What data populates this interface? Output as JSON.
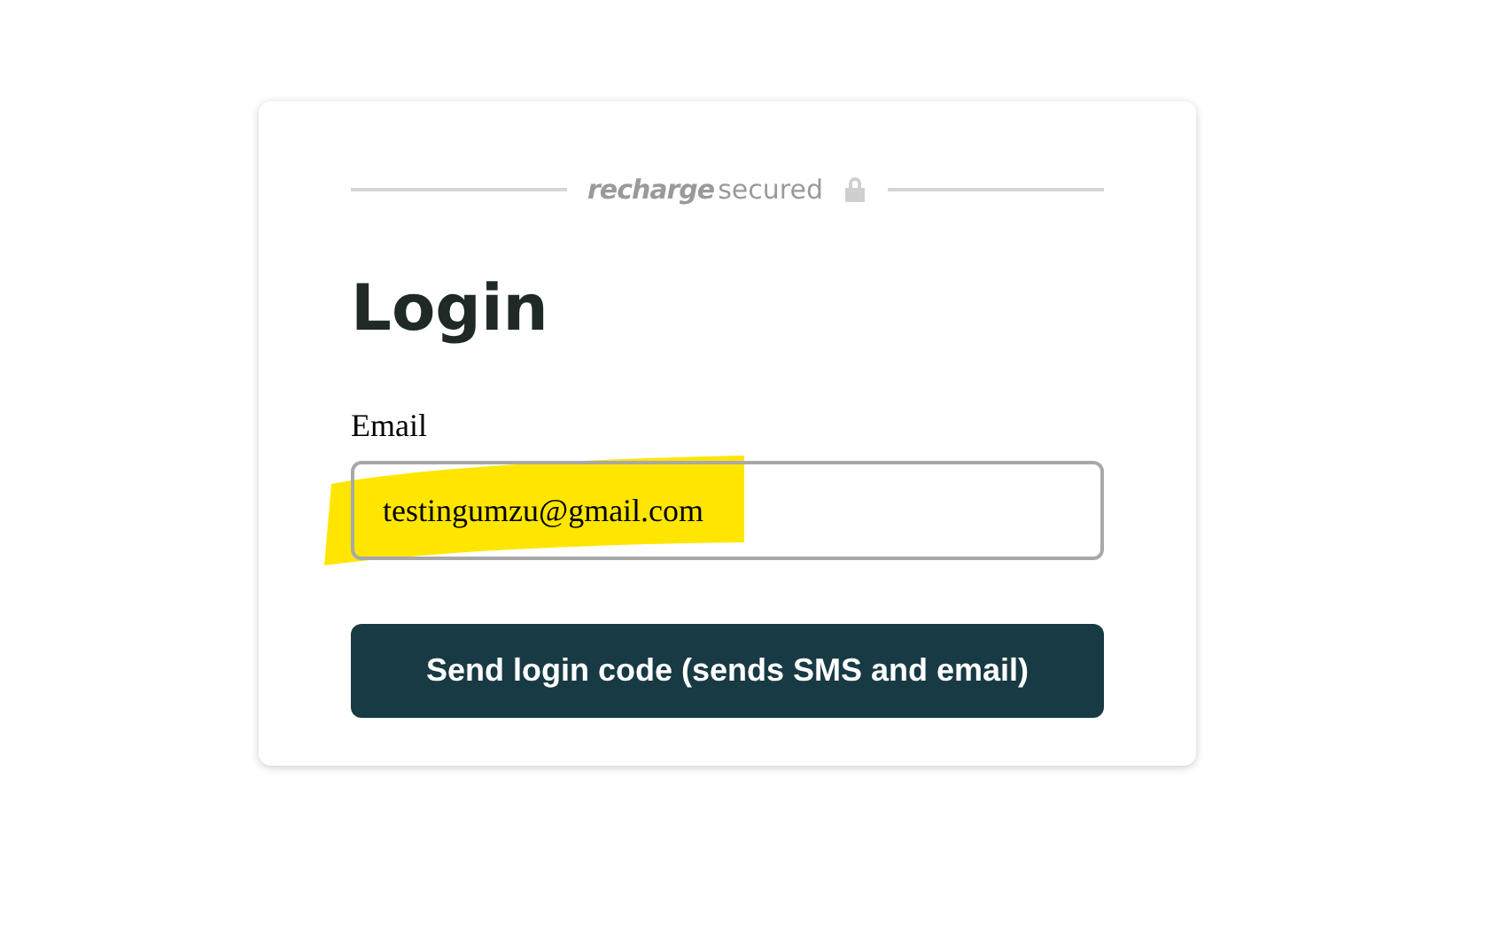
{
  "brand": {
    "name": "recharge",
    "tagline": "secured"
  },
  "title": "Login",
  "email_field": {
    "label": "Email",
    "value": "testingumzu@gmail.com",
    "highlighted": true
  },
  "submit_button": {
    "label": "Send login code (sends SMS and email)"
  }
}
